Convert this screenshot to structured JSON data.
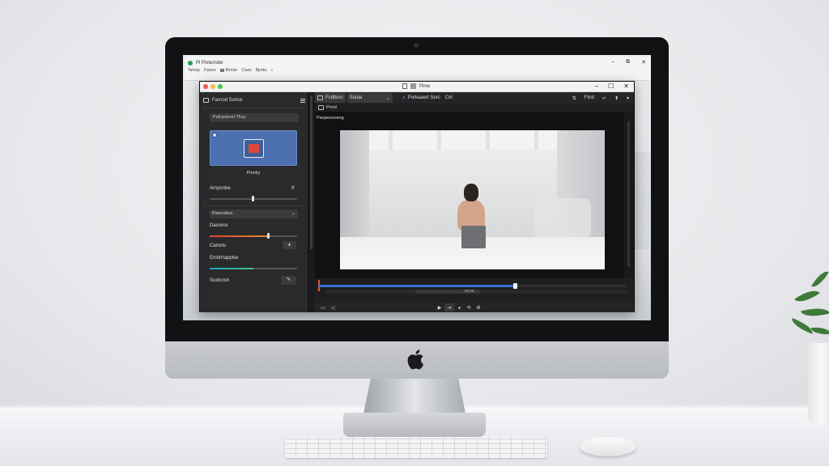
{
  "background_window": {
    "title": "Pl Pixterndw",
    "menu": [
      "Tamnp",
      "Fwoze",
      "Bxrote",
      "Cswn",
      "Bpnks"
    ],
    "controls": [
      "–",
      "⧉",
      "✕"
    ]
  },
  "app_window": {
    "title": "Pinw",
    "controls": [
      "–",
      "☐",
      "✕"
    ],
    "traffic_light_colors": [
      "#ee5b52",
      "#f5bf35",
      "#46c24c"
    ]
  },
  "left_panel": {
    "header": "Farnod Sorlux",
    "search_field": "Pafcpsirxel Thcp",
    "preset_card_label": "Pmnky",
    "accent_color": "#4d71b0",
    "rows": [
      {
        "label": "Arnpcnbe",
        "icon": "≠"
      },
      {
        "label": "Parnvzlies"
      },
      {
        "label": "Dasnnor"
      },
      {
        "label": "Camxis"
      },
      {
        "label": "Enstrrtapplse"
      },
      {
        "label": "Soxlcnsh"
      }
    ],
    "slider_levels": {
      "appearance": 0.5,
      "dasnnor": 0.68,
      "enstrrtapplse": 0.5
    }
  },
  "toolbar": {
    "source_label": "Fcdltorn",
    "preset_label": "Soota",
    "project_label": "Porkaaert Sorc",
    "mode_label": "Cnl",
    "right_label": "Ftnd",
    "sub_label": "Pnnd"
  },
  "viewer": {
    "label": "Paopensosng"
  },
  "timeline": {
    "progress": 0.64,
    "time_label": "00:00"
  },
  "icons": {
    "hamburger": "menu-icon",
    "plus": "plus-icon",
    "edit": "pen-icon",
    "play": "play-icon"
  }
}
